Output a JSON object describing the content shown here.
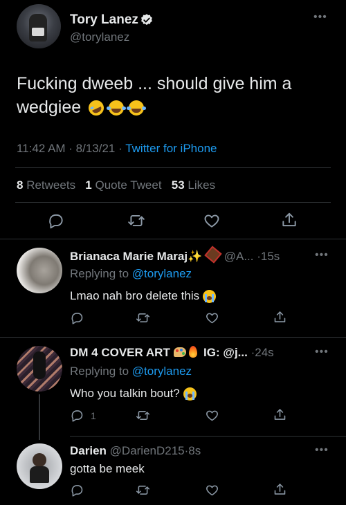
{
  "main_tweet": {
    "author_name": "Tory Lanez",
    "author_handle": "@torylanez",
    "verified": true,
    "text": "Fucking dweeb ... should give him a wedgiee",
    "emojis": [
      "rolling-on-floor-laughing",
      "tears-of-joy",
      "tears-of-joy"
    ],
    "time_date": "11:42 AM · 8/13/21 · ",
    "client": "Twitter for iPhone",
    "stats": {
      "retweets_count": "8",
      "retweets_label": "Retweets",
      "quotes_count": "1",
      "quotes_label": "Quote Tweet",
      "likes_count": "53",
      "likes_label": "Likes"
    }
  },
  "replies": [
    {
      "name": "Brianaca Marie Maraj",
      "handle": "@A...",
      "time": "·15s",
      "replying_prefix": "Replying to ",
      "replying_to": "@torylanez",
      "text": "Lmao nah bro delete this",
      "reply_count": ""
    },
    {
      "name": "DM 4 COVER ART",
      "handle_prefix": "IG: @j...",
      "time": "·24s",
      "replying_prefix": "Replying to ",
      "replying_to": "@torylanez",
      "text": "Who you talkin bout?",
      "reply_count": "1"
    },
    {
      "name": "Darien",
      "handle": "@DarienD215",
      "time": "·8s",
      "text": "gotta be meek",
      "reply_count": ""
    }
  ],
  "colors": {
    "background": "#000000",
    "text": "#e7e9ea",
    "secondary": "#71767b",
    "link": "#1d9bf0",
    "divider": "#2f3336"
  }
}
